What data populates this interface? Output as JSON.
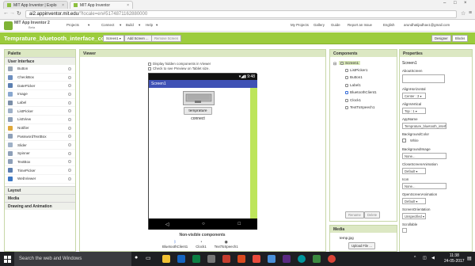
{
  "browser": {
    "tabs": [
      {
        "title": "MIT App Inventor | Explo"
      },
      {
        "title": "MIT App Inventor"
      }
    ],
    "address_host": "ai2.appinventor.mit.edu",
    "address_rest": "/?locale=en#5174871162880000"
  },
  "app_header": {
    "logo_line1": "MIT App Inventor 2",
    "logo_line2": "Beta",
    "menus": [
      "Projects",
      "Connect",
      "Build",
      "Help"
    ],
    "links": [
      "My Projects",
      "Gallery",
      "Guide",
      "Report an Issue",
      "English"
    ],
    "user": "arundhatijadhav1@gmail.com"
  },
  "project_bar": {
    "name": "Temprature_bluetooth_interface_copy",
    "screen_select": "Screen1",
    "add_screen": "Add Screen ...",
    "remove_screen": "Remove Screen",
    "designer": "Designer",
    "blocks": "Blocks"
  },
  "palette": {
    "title": "Palette",
    "category_open": "User Interface",
    "items": [
      {
        "label": "Button",
        "color": "#9aa8b6"
      },
      {
        "label": "CheckBox",
        "color": "#6c8ebf"
      },
      {
        "label": "DatePicker",
        "color": "#5b7fb0"
      },
      {
        "label": "Image",
        "color": "#89a8cf"
      },
      {
        "label": "Label",
        "color": "#7c8fa8"
      },
      {
        "label": "ListPicker",
        "color": "#9fb1c7"
      },
      {
        "label": "ListView",
        "color": "#8ea0b8"
      },
      {
        "label": "Notifier",
        "color": "#e0a93a"
      },
      {
        "label": "PasswordTextBox",
        "color": "#8ea0b8"
      },
      {
        "label": "Slider",
        "color": "#9fb1c7"
      },
      {
        "label": "Spinner",
        "color": "#8ea0b8"
      },
      {
        "label": "TextBox",
        "color": "#8ea0b8"
      },
      {
        "label": "TimePicker",
        "color": "#5b7fb0"
      },
      {
        "label": "WebViewer",
        "color": "#3c78c4"
      }
    ],
    "categories_closed": [
      "Layout",
      "Media",
      "Drawing and Animation"
    ]
  },
  "viewer": {
    "title": "Viewer",
    "checkbox_hidden": "Display hidden components in Viewer",
    "checkbox_tablet": "Check to see Preview on Tablet size.",
    "status_time": "9:48",
    "screen_title": "Screen1",
    "button_label": "temprature",
    "label_text": "connect",
    "nonvisible_title": "Non-visible components",
    "nonvisible": [
      "BluetoothClient1",
      "Clock1",
      "TextToSpeech1"
    ]
  },
  "components": {
    "title": "Components",
    "tree": [
      "Screen1",
      "ListPicker1",
      "Button1",
      "Label1",
      "BluetoothClient1",
      "Clock1",
      "TextToSpeech1"
    ],
    "rename": "Rename",
    "delete": "Delete"
  },
  "media": {
    "title": "Media",
    "file": "temp.jpg",
    "upload": "Upload File ..."
  },
  "properties": {
    "title": "Properties",
    "screen": "Screen1",
    "items": [
      {
        "label": "AboutScreen",
        "value": ""
      },
      {
        "label": "AlignHorizontal",
        "value": "Center : 3 ▾"
      },
      {
        "label": "AlignVertical",
        "value": "Top : 1 ▾"
      },
      {
        "label": "AppName",
        "value": "Temprature_bluetooth_interfa"
      },
      {
        "label": "BackgroundColor",
        "value": "White"
      },
      {
        "label": "BackgroundImage",
        "value": "None..."
      },
      {
        "label": "CloseScreenAnimation",
        "value": "Default ▾"
      },
      {
        "label": "Icon",
        "value": "None..."
      },
      {
        "label": "OpenScreenAnimation",
        "value": "Default ▾"
      },
      {
        "label": "ScreenOrientation",
        "value": "Unspecified ▾"
      },
      {
        "label": "Scrollable",
        "value": ""
      }
    ]
  },
  "taskbar": {
    "search_placeholder": "Search the web and Windows",
    "time": "11:38",
    "date": "24-05-2017"
  }
}
